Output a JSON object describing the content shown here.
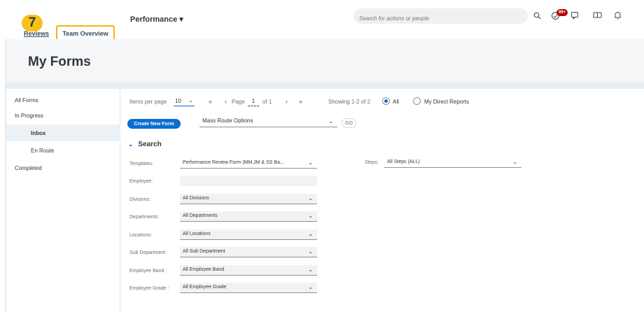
{
  "tabs": {
    "badge": "7",
    "reviews": "Reviews",
    "team_overview": "Team Overview"
  },
  "header": {
    "performance": "Performance ▾",
    "search_placeholder": "Search for actions or people",
    "notif_count": "99+"
  },
  "page": {
    "title": "My Forms"
  },
  "sidebar": {
    "items": [
      {
        "label": "All Forms"
      },
      {
        "label": "In Progress"
      },
      {
        "label": "Inbox"
      },
      {
        "label": "En Route"
      },
      {
        "label": "Completed"
      }
    ]
  },
  "paging": {
    "items_per_page_label": "Items per page",
    "items_per_page_value": "10",
    "first": "«",
    "prev": "‹",
    "page_label": "Page",
    "page_value": "1",
    "of_label": "of 1",
    "next": "›",
    "last": "»",
    "showing": "Showing 1-2 of 2",
    "filter_all": "All",
    "filter_direct": "My Direct Reports"
  },
  "actions": {
    "create_new_form": "Create New Form",
    "mass_route": "Mass Route Options",
    "go": "GO"
  },
  "search": {
    "header": "Search",
    "templates_label": "Templates:",
    "templates_value": "Performance Review Form (MM,JM & SS Ba...",
    "steps_label": "Steps:",
    "steps_value": "All Steps (ALL)",
    "employee_label": "Employee:",
    "divisions_label": "Divisions:",
    "divisions_value": "All Divisions",
    "departments_label": "Departments:",
    "departments_value": "All Departments",
    "locations_label": "Locations:",
    "locations_value": "All Locations",
    "sub_department_label": "Sub Department :",
    "sub_department_value": "All Sub Department",
    "employee_band_label": "Employee Band :",
    "employee_band_value": "All Employee Band",
    "employee_grade_label": "Employee Grade :",
    "employee_grade_value": "All Employee Grade"
  },
  "colors": {
    "accent": "#0a6ed1",
    "highlight": "#f2b517",
    "badge": "#bb0000"
  }
}
